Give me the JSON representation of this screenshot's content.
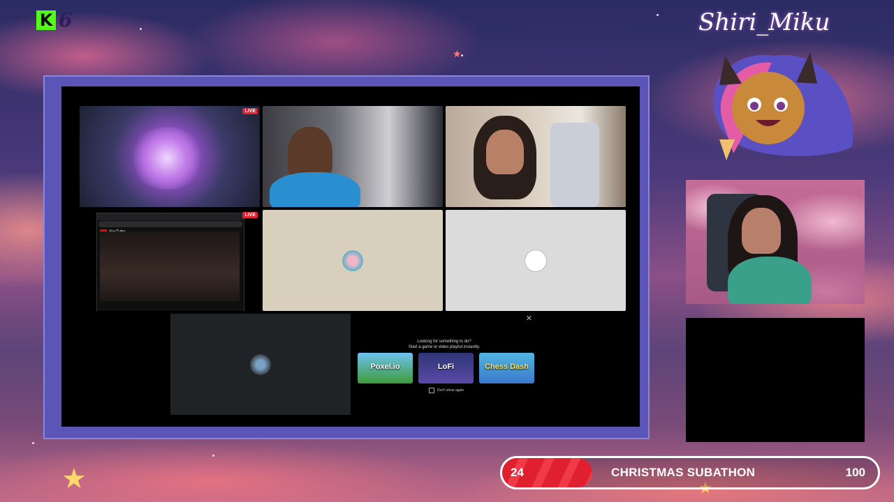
{
  "kick_logo": {
    "letter": "K",
    "count": "6"
  },
  "streamer_name": "Shiri_Miku",
  "stream_grid": {
    "tiles": [
      {
        "name": "game-stream",
        "live_badge": "LIVE"
      },
      {
        "name": "webcam-man"
      },
      {
        "name": "webcam-woman"
      },
      {
        "name": "youtube-screen-share",
        "live_badge": "LIVE",
        "site": "YouTube"
      },
      {
        "name": "avatar-tile-1"
      },
      {
        "name": "avatar-tile-2"
      },
      {
        "name": "avatar-tile-3"
      }
    ]
  },
  "promo": {
    "line1": "Looking for something to do?",
    "line2": "Start a game or video playlist instantly.",
    "cards": [
      "Poxel.io",
      "LoFi",
      "Chess Dash"
    ],
    "dont_show": "Don't show again",
    "close": "✕"
  },
  "subathon": {
    "title": "CHRISTMAS SUBATHON",
    "current": "24",
    "goal": "100",
    "progress": 0.24,
    "fill_color": "#e0202f"
  },
  "colors": {
    "frame": "#5c55b8",
    "kick_green": "#53fc18"
  }
}
